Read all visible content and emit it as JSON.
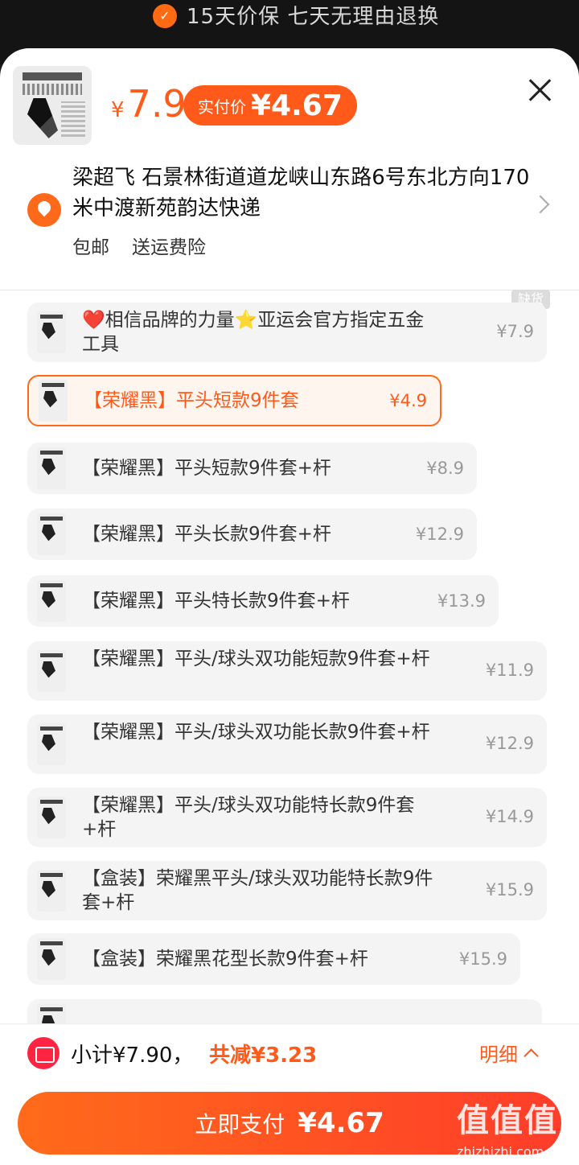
{
  "header": {
    "guarantee_text": "15天价保  七天无理由退换"
  },
  "product": {
    "currency": "¥",
    "price": "7.9",
    "paid_label": "实付价",
    "paid_amount": "¥4.67"
  },
  "address": {
    "text": "梁超飞  石景林街道道龙峡山东路6号东北方向170米中渡新苑韵达快递",
    "tags": [
      "包邮",
      "送运费险"
    ]
  },
  "stock_badge": "缺货",
  "skus": [
    {
      "name": "❤️相信品牌的力量⭐亚运会官方指定五金工具",
      "price": "¥7.9"
    },
    {
      "name": "【荣耀黑】平头短款9件套",
      "price": "¥4.9"
    },
    {
      "name": "【荣耀黑】平头短款9件套+杆",
      "price": "¥8.9"
    },
    {
      "name": "【荣耀黑】平头长款9件套+杆",
      "price": "¥12.9"
    },
    {
      "name": "【荣耀黑】平头特长款9件套+杆",
      "price": "¥13.9"
    },
    {
      "name": "【荣耀黑】平头/球头双功能短款9件套+杆",
      "price": "¥11.9"
    },
    {
      "name": "【荣耀黑】平头/球头双功能长款9件套+杆",
      "price": "¥12.9"
    },
    {
      "name": "【荣耀黑】平头/球头双功能特长款9件套+杆",
      "price": "¥14.9"
    },
    {
      "name": "【盒装】荣耀黑平头/球头双功能特长款9件套+杆",
      "price": "¥15.9"
    },
    {
      "name": "【盒装】荣耀黑花型长款9件套+杆",
      "price": "¥15.9"
    }
  ],
  "footer": {
    "subtotal": "小计¥7.90，",
    "discount": "共减¥3.23",
    "detail_label": "明细",
    "pay_label": "立即支付",
    "pay_amount": "¥4.67"
  },
  "watermark": {
    "main": "值值值",
    "sub": "zhizhizhi.com"
  }
}
